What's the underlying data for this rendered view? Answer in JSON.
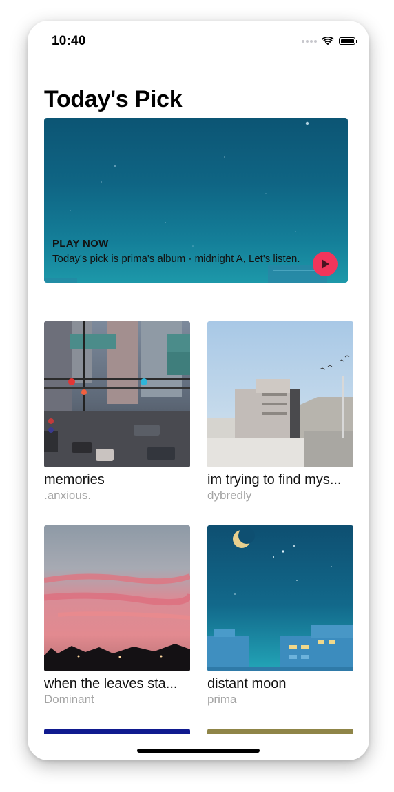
{
  "status_bar": {
    "time": "10:40"
  },
  "page": {
    "title": "Today's Pick"
  },
  "featured": {
    "label": "PLAY NOW",
    "description": "Today's pick is prima's album - midnight A, Let's listen.",
    "play_icon": "play-icon",
    "accent_color": "#f2355b"
  },
  "albums": [
    {
      "title": "memories",
      "artist": ".anxious."
    },
    {
      "title": "im trying to find mys...",
      "artist": "dybredly"
    },
    {
      "title": "when the leaves sta...",
      "artist": "Dominant"
    },
    {
      "title": "distant moon",
      "artist": "prima"
    }
  ],
  "colors": {
    "text_primary": "#111111",
    "text_secondary": "#a3a3a3",
    "play_button": "#f2355b"
  }
}
